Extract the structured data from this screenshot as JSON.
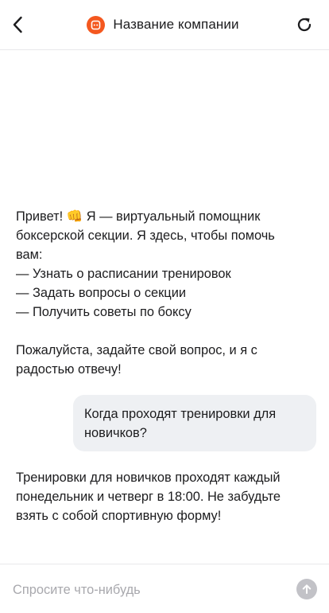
{
  "header": {
    "title": "Название компании",
    "back_icon": "chevron-left-icon",
    "refresh_icon": "refresh-icon",
    "logo_icon": "company-logo-icon",
    "accent_color": "#f4581f"
  },
  "messages": [
    {
      "role": "bot",
      "lines": [
        "Привет! 👊 Я — виртуальный помощник",
        "боксерской секции. Я здесь, чтобы помочь",
        "вам:",
        "— Узнать о расписании тренировок",
        "— Задать вопросы о секции",
        "— Получить советы по боксу",
        "",
        "Пожалуйста, задайте свой вопрос, и я с",
        "радостью отвечу!"
      ]
    },
    {
      "role": "user",
      "lines": [
        "Когда проходят тренировки для",
        "новичков?"
      ]
    },
    {
      "role": "bot",
      "lines": [
        "Тренировки для новичков проходят каждый",
        "понедельник и четверг в 18:00. Не забудьте",
        "взять с собой спортивную форму!"
      ]
    }
  ],
  "composer": {
    "placeholder": "Спросите что-нибудь",
    "value": "",
    "send_icon": "arrow-up-icon"
  }
}
